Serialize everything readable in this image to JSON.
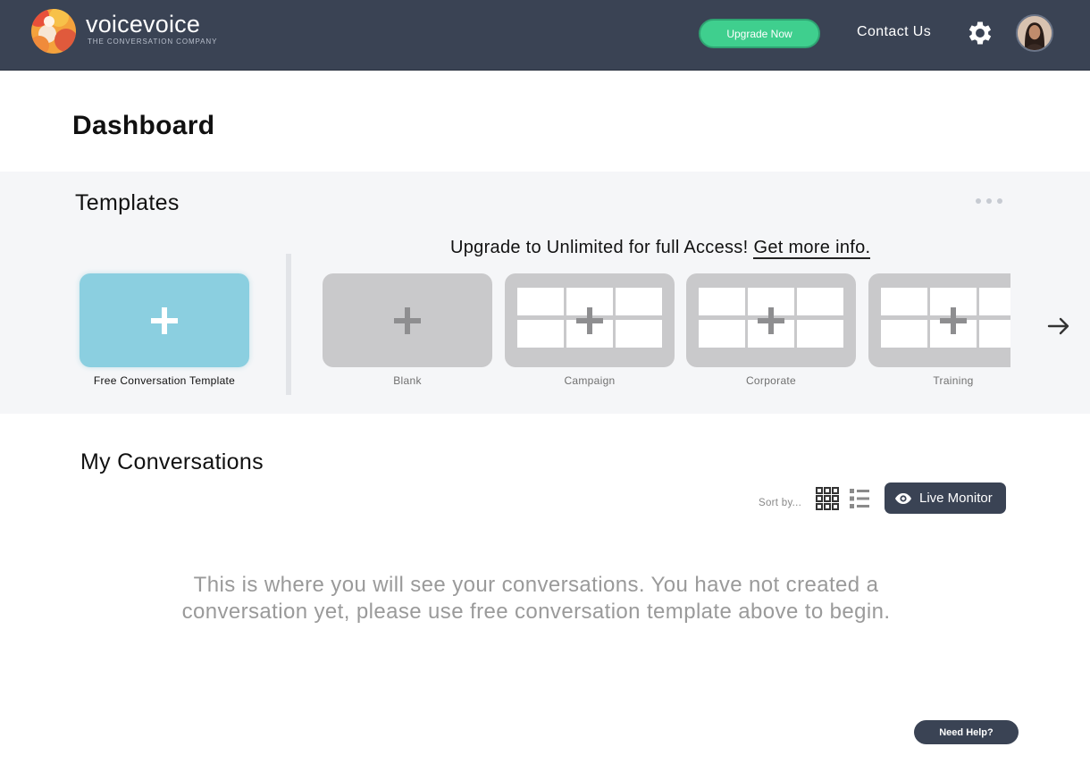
{
  "header": {
    "brand": "voicevoice",
    "tagline": "THE CONVERSATION COMPANY",
    "upgrade_label": "Upgrade Now",
    "contact_label": "Contact Us"
  },
  "page": {
    "title": "Dashboard"
  },
  "templates": {
    "title": "Templates",
    "upgrade_text": "Upgrade to Unlimited for full Access!",
    "upgrade_link": "Get more info.",
    "free_template_label": "Free Conversation Template",
    "items": [
      {
        "label": "Blank"
      },
      {
        "label": "Campaign"
      },
      {
        "label": "Corporate"
      },
      {
        "label": "Training"
      }
    ]
  },
  "conversations": {
    "title": "My Conversations",
    "sort_label": "Sort by...",
    "live_monitor_label": "Live Monitor",
    "empty_message": "This is where you will see your conversations. You have not created a conversation yet, please use free conversation template above to begin."
  },
  "help": {
    "label": "Need Help?"
  },
  "colors": {
    "header_bg": "#3a4354",
    "accent_green": "#3fcf8e",
    "free_template": "#8bcfe0",
    "template_card": "#c9c9cb"
  },
  "icons": [
    "logo-icon",
    "gear-icon",
    "avatar",
    "plus-icon",
    "more-dots-icon",
    "arrow-right-icon",
    "grid-view-icon",
    "list-view-icon",
    "eye-icon"
  ]
}
